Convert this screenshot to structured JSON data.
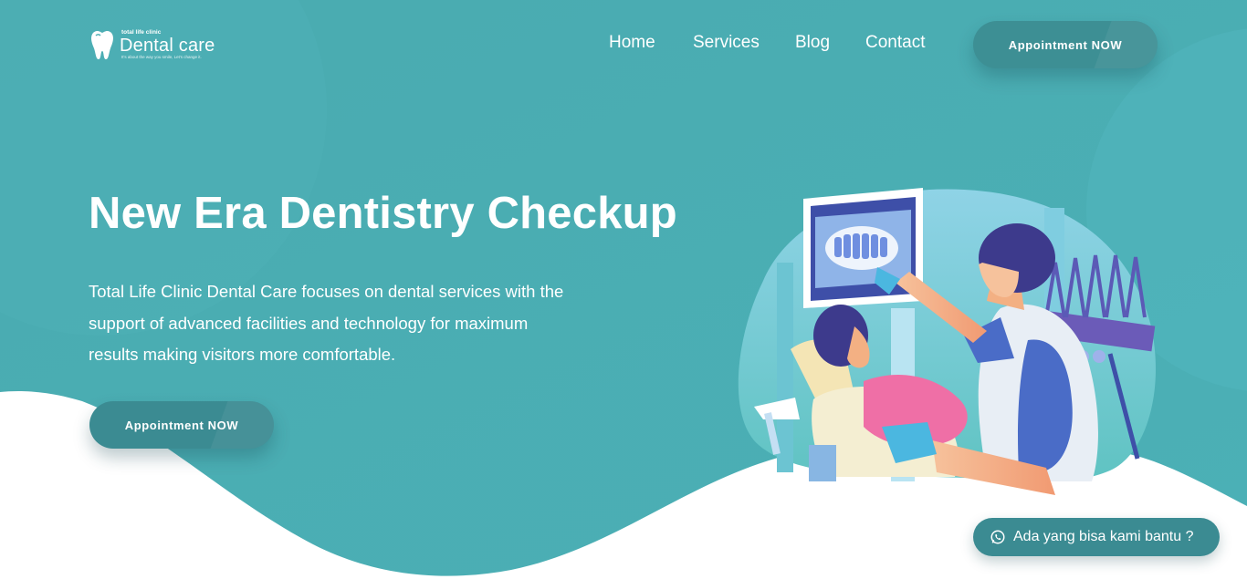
{
  "brand": {
    "small": "total life clinic",
    "name": "Dental care",
    "tagline": "It's about the way you smile, Let's change it."
  },
  "nav": {
    "items": [
      {
        "label": "Home"
      },
      {
        "label": "Services"
      },
      {
        "label": "Blog"
      },
      {
        "label": "Contact"
      }
    ],
    "cta_label": "Appointment NOW"
  },
  "hero": {
    "title": "New Era Dentistry Checkup",
    "description_lines": [
      "Total Life Clinic Dental Care focuses on dental services with the",
      "support of advanced facilities and technology for maximum",
      "results making visitors more comfortable."
    ],
    "cta_label": "Appointment NOW"
  },
  "chat": {
    "label": "Ada yang bisa kami bantu ?",
    "icon": "whatsapp-icon"
  },
  "colors": {
    "primary": "#4aadb2",
    "button": "#3b8b92",
    "white": "#ffffff"
  }
}
